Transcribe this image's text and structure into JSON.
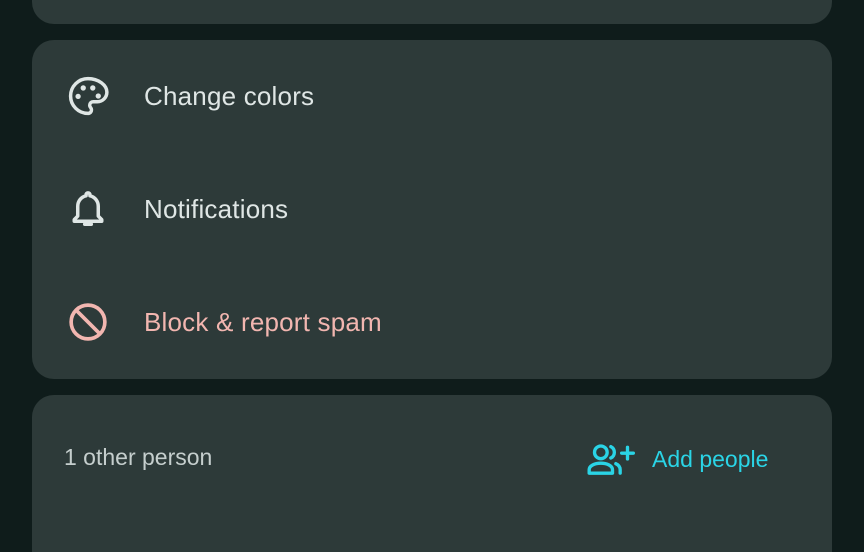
{
  "settings": {
    "items": [
      {
        "label": "Change colors",
        "icon": "palette-icon"
      },
      {
        "label": "Notifications",
        "icon": "bell-icon"
      },
      {
        "label": "Block & report spam",
        "icon": "block-icon"
      }
    ]
  },
  "people": {
    "count_label": "1 other person",
    "add_label": "Add people",
    "add_icon": "person-add-icon"
  },
  "colors": {
    "background": "#0f1c1b",
    "card": "#2d3a39",
    "text": "#dfe6e5",
    "danger": "#f2b6b0",
    "accent": "#2ad4e6"
  }
}
